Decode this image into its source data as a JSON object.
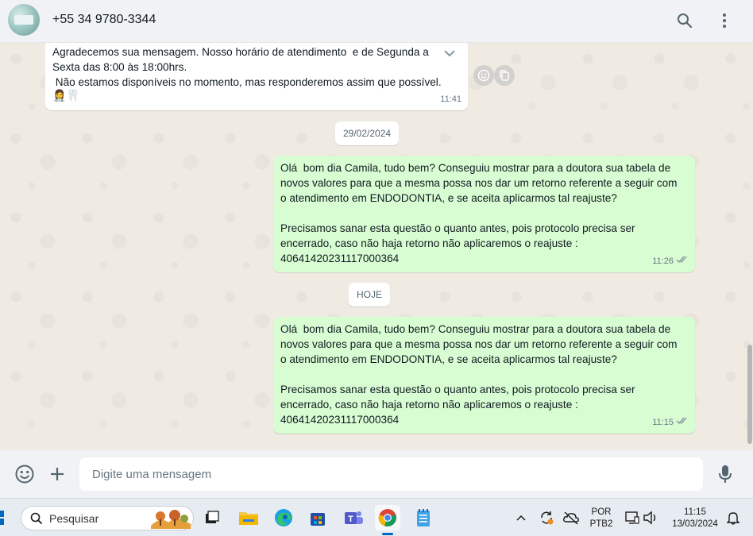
{
  "header": {
    "contact_name": "+55 34 9780-3344",
    "icons": [
      "search-icon",
      "more-vertical-icon"
    ]
  },
  "messages": {
    "auto_reply": {
      "text": "Agradecemos sua mensagem. Nosso horário de atendimento  e de Segunda a\nSexta das 8:00 às 18:00hrs.\n Não estamos disponíveis no momento, mas responderemos assim que possível.",
      "emoji": "👩‍⚕️🦷",
      "time": "11:41"
    },
    "date_1": "29/02/2024",
    "msg_1": {
      "text": "Olá  bom dia Camila, tudo bem? Conseguiu mostrar para a doutora sua tabela de\nnovos valores para que a mesma possa nos dar um retorno referente a seguir com\no atendimento em ENDODONTIA, e se aceita aplicarmos tal reajuste?\n\nPrecisamos sanar esta questão o quanto antes, pois protocolo precisa ser\nencerrado, caso não haja retorno não aplicaremos o reajuste :\n40641420231117000364",
      "time": "11:26"
    },
    "date_2": "HOJE",
    "msg_2": {
      "text": "Olá  bom dia Camila, tudo bem? Conseguiu mostrar para a doutora sua tabela de\nnovos valores para que a mesma possa nos dar um retorno referente a seguir com\no atendimento em ENDODONTIA, e se aceita aplicarmos tal reajuste?\n\nPrecisamos sanar esta questão o quanto antes, pois protocolo precisa ser\nencerrado, caso não haja retorno não aplicaremos o reajuste :\n40641420231117000364",
      "time": "11:15"
    }
  },
  "composer": {
    "placeholder": "Digite uma mensagem"
  },
  "taskbar": {
    "search_label": "Pesquisar",
    "lang_1": "POR",
    "lang_2": "PTB2",
    "time": "11:15",
    "date": "13/03/2024"
  },
  "colors": {
    "outgoing_bubble": "#d9fdd3",
    "incoming_bubble": "#ffffff",
    "chat_bg": "#efeae2",
    "panel": "#f0f2f5",
    "tick": "#8696a0"
  }
}
